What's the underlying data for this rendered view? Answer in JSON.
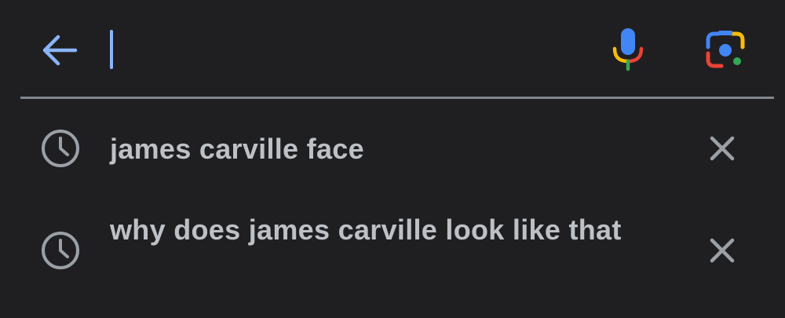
{
  "search": {
    "value": "",
    "placeholder": ""
  },
  "icons": {
    "back": "arrow-back-icon",
    "mic": "mic-icon",
    "lens": "google-lens-icon",
    "history": "history-clock-icon",
    "remove": "close-x-icon"
  },
  "colors": {
    "background": "#1f1f21",
    "accent": "#8ab4f8",
    "text": "#bdc1c6",
    "icon_gray": "#9aa0a6",
    "divider": "#80868b",
    "google_blue": "#4285f4",
    "google_red": "#ea4335",
    "google_yellow": "#fbbc04",
    "google_green": "#34a853"
  },
  "suggestions": [
    {
      "text": "james carville face"
    },
    {
      "text": "why does james carville look like that"
    }
  ]
}
